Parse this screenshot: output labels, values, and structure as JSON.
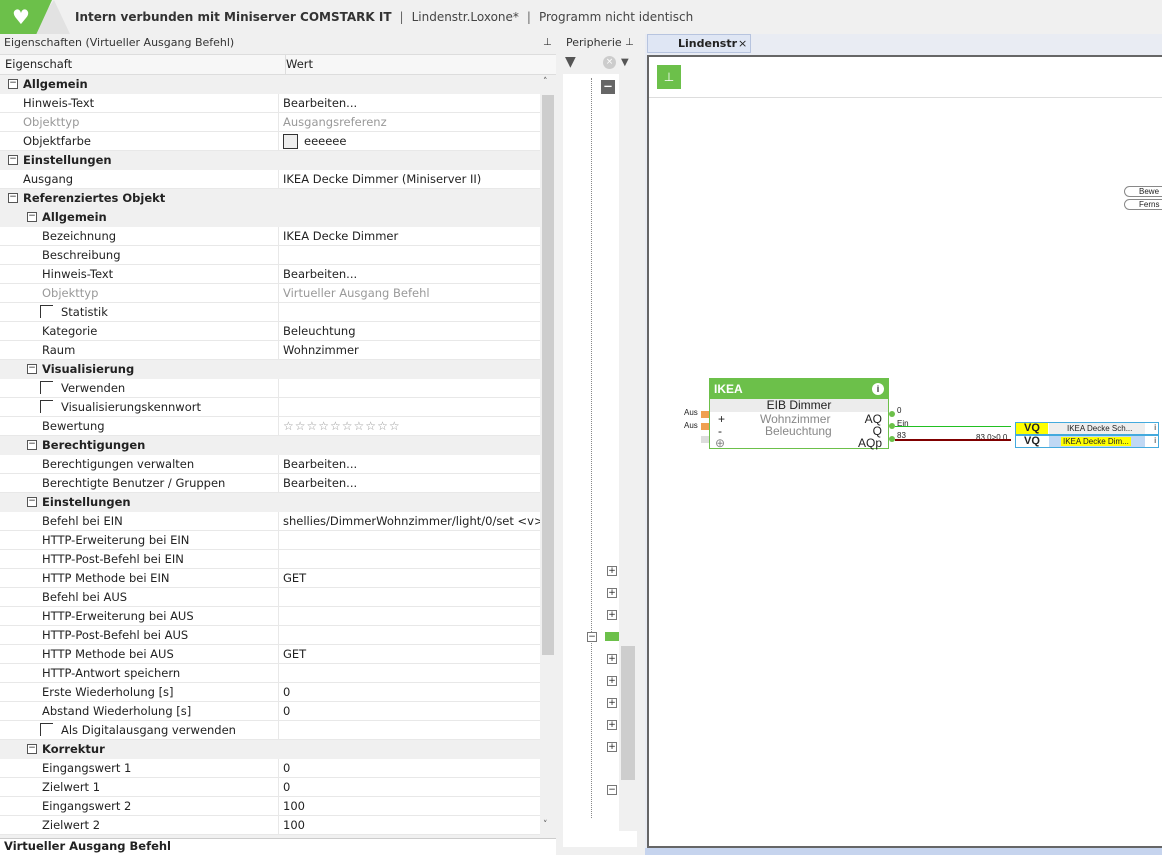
{
  "title": {
    "connection": "Intern verbunden mit Miniserver COMSTARK IT",
    "file": "Lindenstr.Loxone*",
    "status": "Programm nicht identisch",
    "sep": "|"
  },
  "properties_panel": {
    "title": "Eigenschaften (Virtueller Ausgang Befehl)",
    "col_property": "Eigenschaft",
    "col_value": "Wert",
    "footer": "Virtueller Ausgang Befehl",
    "rows": [
      {
        "t": "g",
        "l": 0,
        "label": "Allgemein"
      },
      {
        "t": "p",
        "l": 0,
        "label": "Hinweis-Text",
        "value": "Bearbeiten..."
      },
      {
        "t": "p",
        "l": 0,
        "label": "Objekttyp",
        "value": "Ausgangsreferenz",
        "gray": true
      },
      {
        "t": "c",
        "l": 0,
        "label": "Objektfarbe",
        "value": "eeeeee",
        "swatch": "#eeeeee"
      },
      {
        "t": "g",
        "l": 0,
        "label": "Einstellungen"
      },
      {
        "t": "p",
        "l": 0,
        "label": "Ausgang",
        "value": "IKEA Decke Dimmer (Miniserver II)"
      },
      {
        "t": "g",
        "l": 0,
        "label": "Referenziertes Objekt"
      },
      {
        "t": "g",
        "l": 1,
        "label": "Allgemein"
      },
      {
        "t": "p",
        "l": 1,
        "label": "Bezeichnung",
        "value": "IKEA Decke Dimmer"
      },
      {
        "t": "p",
        "l": 1,
        "label": "Beschreibung",
        "value": ""
      },
      {
        "t": "p",
        "l": 1,
        "label": "Hinweis-Text",
        "value": "Bearbeiten..."
      },
      {
        "t": "p",
        "l": 1,
        "label": "Objekttyp",
        "value": "Virtueller Ausgang Befehl",
        "gray": true
      },
      {
        "t": "x",
        "l": 1,
        "label": "Statistik"
      },
      {
        "t": "p",
        "l": 1,
        "label": "Kategorie",
        "value": "Beleuchtung"
      },
      {
        "t": "p",
        "l": 1,
        "label": "Raum",
        "value": "Wohnzimmer"
      },
      {
        "t": "g",
        "l": 1,
        "label": "Visualisierung"
      },
      {
        "t": "x",
        "l": 1,
        "label": "Verwenden"
      },
      {
        "t": "x",
        "l": 1,
        "label": "Visualisierungskennwort"
      },
      {
        "t": "s",
        "l": 1,
        "label": "Bewertung",
        "value": "☆☆☆☆☆☆☆☆☆☆",
        "rating": 0
      },
      {
        "t": "g",
        "l": 1,
        "label": "Berechtigungen"
      },
      {
        "t": "p",
        "l": 1,
        "label": "Berechtigungen verwalten",
        "value": "Bearbeiten..."
      },
      {
        "t": "p",
        "l": 1,
        "label": "Berechtigte Benutzer / Gruppen",
        "value": "Bearbeiten..."
      },
      {
        "t": "g",
        "l": 1,
        "label": "Einstellungen"
      },
      {
        "t": "p",
        "l": 1,
        "label": "Befehl bei EIN",
        "value": "shellies/DimmerWohnzimmer/light/0/set  <v>"
      },
      {
        "t": "p",
        "l": 1,
        "label": "HTTP-Erweiterung bei EIN",
        "value": ""
      },
      {
        "t": "p",
        "l": 1,
        "label": "HTTP-Post-Befehl bei EIN",
        "value": ""
      },
      {
        "t": "p",
        "l": 1,
        "label": "HTTP Methode bei EIN",
        "value": "GET"
      },
      {
        "t": "p",
        "l": 1,
        "label": "Befehl bei AUS",
        "value": ""
      },
      {
        "t": "p",
        "l": 1,
        "label": "HTTP-Erweiterung bei AUS",
        "value": ""
      },
      {
        "t": "p",
        "l": 1,
        "label": "HTTP-Post-Befehl bei AUS",
        "value": ""
      },
      {
        "t": "p",
        "l": 1,
        "label": "HTTP Methode bei AUS",
        "value": "GET"
      },
      {
        "t": "p",
        "l": 1,
        "label": "HTTP-Antwort speichern",
        "value": ""
      },
      {
        "t": "p",
        "l": 1,
        "label": "Erste Wiederholung [s]",
        "value": "0"
      },
      {
        "t": "p",
        "l": 1,
        "label": "Abstand Wiederholung [s]",
        "value": "0"
      },
      {
        "t": "x",
        "l": 1,
        "label": "Als Digitalausgang verwenden"
      },
      {
        "t": "g",
        "l": 1,
        "label": "Korrektur"
      },
      {
        "t": "p",
        "l": 1,
        "label": "Eingangswert 1",
        "value": "0"
      },
      {
        "t": "p",
        "l": 1,
        "label": "Zielwert 1",
        "value": "0"
      },
      {
        "t": "p",
        "l": 1,
        "label": "Eingangswert 2",
        "value": "100"
      },
      {
        "t": "p",
        "l": 1,
        "label": "Zielwert 2",
        "value": "100"
      }
    ]
  },
  "peripherie": {
    "title": "Peripherie"
  },
  "canvas": {
    "tab": "Lindenstr",
    "block": {
      "title": "IKEA",
      "type": "EIB Dimmer",
      "room": "Wohnzimmer",
      "category": "Beleuchtung",
      "in_plus": "+",
      "in_minus": "-",
      "in1_value": "Aus",
      "in2_value": "Aus",
      "out_aq": "AQ",
      "out_q": "Q",
      "out_aqp": "AQp",
      "aq_value": "0",
      "q_value": "Ein",
      "aqp_value": "83",
      "line_value": "83.0>0.0"
    },
    "outputs": [
      {
        "label": "VQ",
        "name": "IKEA Decke Sch..."
      },
      {
        "label": "VQ",
        "name": "IKEA Decke Dim..."
      }
    ],
    "notes": [
      "Bewe",
      "Ferns"
    ]
  }
}
